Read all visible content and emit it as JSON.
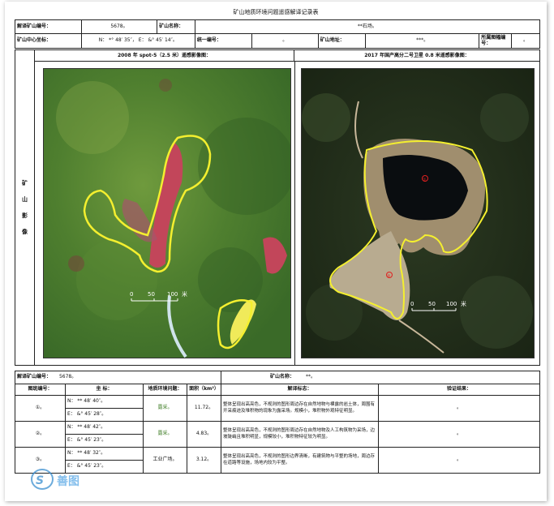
{
  "title": "矿山地质环境问题遥感解译记录表",
  "header": {
    "row1": {
      "label_code": "解译矿山编号：",
      "code": "5678。",
      "label_name": "矿山名称：",
      "name": "**石场。"
    },
    "row2": {
      "label_center": "矿山中心坐标：",
      "coord": "N： *° 48′ 35″， E： &° 45′ 14″。",
      "label_unified": "统一编号：",
      "unified": "。",
      "label_addr": "矿山地址：",
      "addr": "***。",
      "label_map": "所属图幅编号：",
      "map": "。"
    }
  },
  "images": {
    "side_label": [
      "矿",
      "山",
      "影",
      "像"
    ],
    "left_title": "2008 年 spot-5（2.5 米）遥感影像图：",
    "right_title": "2017 年国产高分二号卫星 0.8 米遥感影像图：",
    "scale": {
      "n0": "0",
      "n1": "50",
      "n2": "100",
      "unit": "米"
    },
    "markers": {
      "m1": "①",
      "m2": "②"
    }
  },
  "bottom": {
    "label_code": "解译矿山编号：",
    "code": "5678。",
    "label_name": "矿山名称：",
    "name": "**。",
    "cols": {
      "spot": "图斑编号：",
      "coord": "坐    标：",
      "issue": "地质环境问题：",
      "area": "面积（km²）",
      "mark": "解译标志：",
      "verify": "验证结果："
    },
    "rows": [
      {
        "id": "①。",
        "N": "N： **  48′  40″。",
        "E": "E： &°  45′  28″。",
        "issue": "露采。",
        "area": "11.72。",
        "mark": "整体呈现出高亮色，不规则的图形周边存在自然地物与裸露的岩土体，周围有开采痕迹及堆积物的现象为露采场。规模小，堆积物外观特征明显。",
        "verify": "。"
      },
      {
        "id": "②。",
        "N": "N： **  48′  42″。",
        "E": "E： &°  45′  23″。",
        "issue": "露采。",
        "area": "4.83。",
        "mark": "整体呈现出高亮色，不规则的图形周边存在自然地物及人工构筑物为采场，边坡陡峭且堆积明显，规模较小，堆积物特征较为明显。",
        "verify": "。"
      },
      {
        "id": "③。",
        "N": "N： **  48′  32″。",
        "E": "E： &°  45′  23″。",
        "issue": "工业广场。",
        "area": "3.12。",
        "mark": "整体呈现出高亮色，不规则的图形边界清晰，有建筑物与平整的场地，周边存在道路等设施，场地内较为平整。",
        "verify": "。"
      }
    ]
  },
  "watermark": "善图"
}
